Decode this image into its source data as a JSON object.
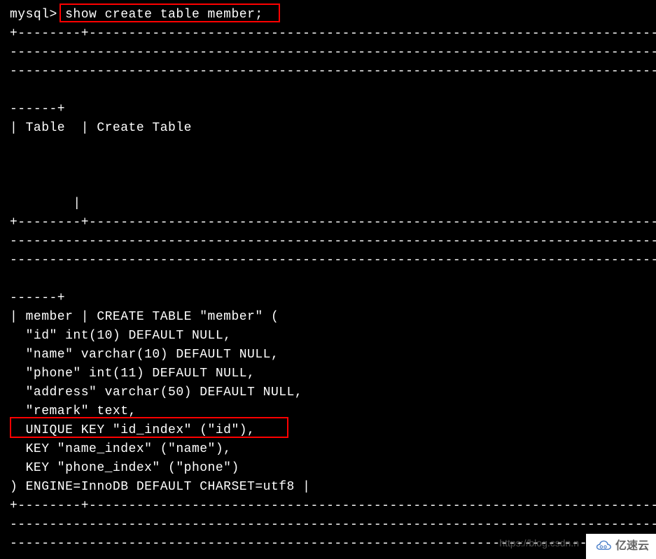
{
  "terminal": {
    "prompt": "mysql>",
    "command": "show create table member;",
    "separator1": "+--------+-------------------------------------------------------------------------------",
    "separator2": "--------------------------------------------------------------------------------------------",
    "separator3": "--------------------------------------------------------------------------------------------",
    "separator_end": "------+",
    "header_line": "| Table  | Create Table",
    "pipe_mid": "        |",
    "result_line_1": "| member | CREATE TABLE \"member\" (",
    "result_line_2": "  \"id\" int(10) DEFAULT NULL,",
    "result_line_3": "  \"name\" varchar(10) DEFAULT NULL,",
    "result_line_4": "  \"phone\" int(11) DEFAULT NULL,",
    "result_line_5": "  \"address\" varchar(50) DEFAULT NULL,",
    "result_line_6": "  \"remark\" text,",
    "result_line_7": "  UNIQUE KEY \"id_index\" (\"id\"),",
    "result_line_8": "  KEY \"name_index\" (\"name\"),",
    "result_line_9": "  KEY \"phone_index\" (\"phone\")",
    "result_line_10": ") ENGINE=InnoDB DEFAULT CHARSET=utf8 |"
  },
  "watermark": {
    "text": "https://blog.csdn.n",
    "brand": "亿速云"
  }
}
